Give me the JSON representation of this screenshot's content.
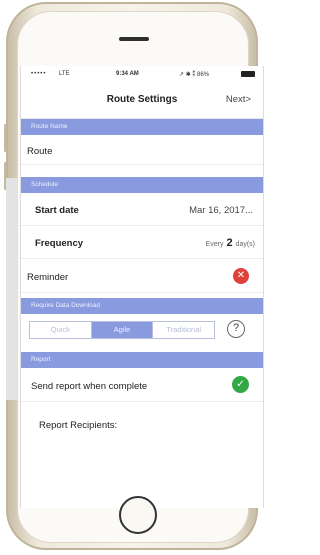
{
  "status_bar": {
    "signal": "•••••",
    "carrier": "LTE",
    "time": "9:34 AM",
    "indicators": "↗ ✱ ⁑ 86%"
  },
  "nav": {
    "title": "Route Settings",
    "next_label": "Next>"
  },
  "sections": {
    "route_name": "Route Name",
    "schedule": "Schedule",
    "require_data": "Require Data Download",
    "report": "Report"
  },
  "route_name": {
    "value": "Route"
  },
  "schedule": {
    "start_date_label": "Start date",
    "start_date_value": "Mar 16, 2017...",
    "frequency_label": "Frequency",
    "frequency_prefix": "Every",
    "frequency_number": "2",
    "frequency_unit": "day(s)",
    "reminder_label": "Reminder",
    "reminder_state": "off"
  },
  "data_download": {
    "options": [
      "Quick",
      "Agile",
      "Traditional"
    ],
    "selected": "Agile",
    "help": "?"
  },
  "report": {
    "send_label": "Send report when complete",
    "send_state": "on",
    "recipients_label": "Report Recipients:"
  },
  "colors": {
    "section_header": "#8a9adf",
    "toggle_off": "#e0413b",
    "toggle_on": "#34a844"
  },
  "icons": {
    "reminder_toggle": "x-circle-icon",
    "send_toggle": "checkmark-circle-icon",
    "help": "question-circle-icon"
  }
}
